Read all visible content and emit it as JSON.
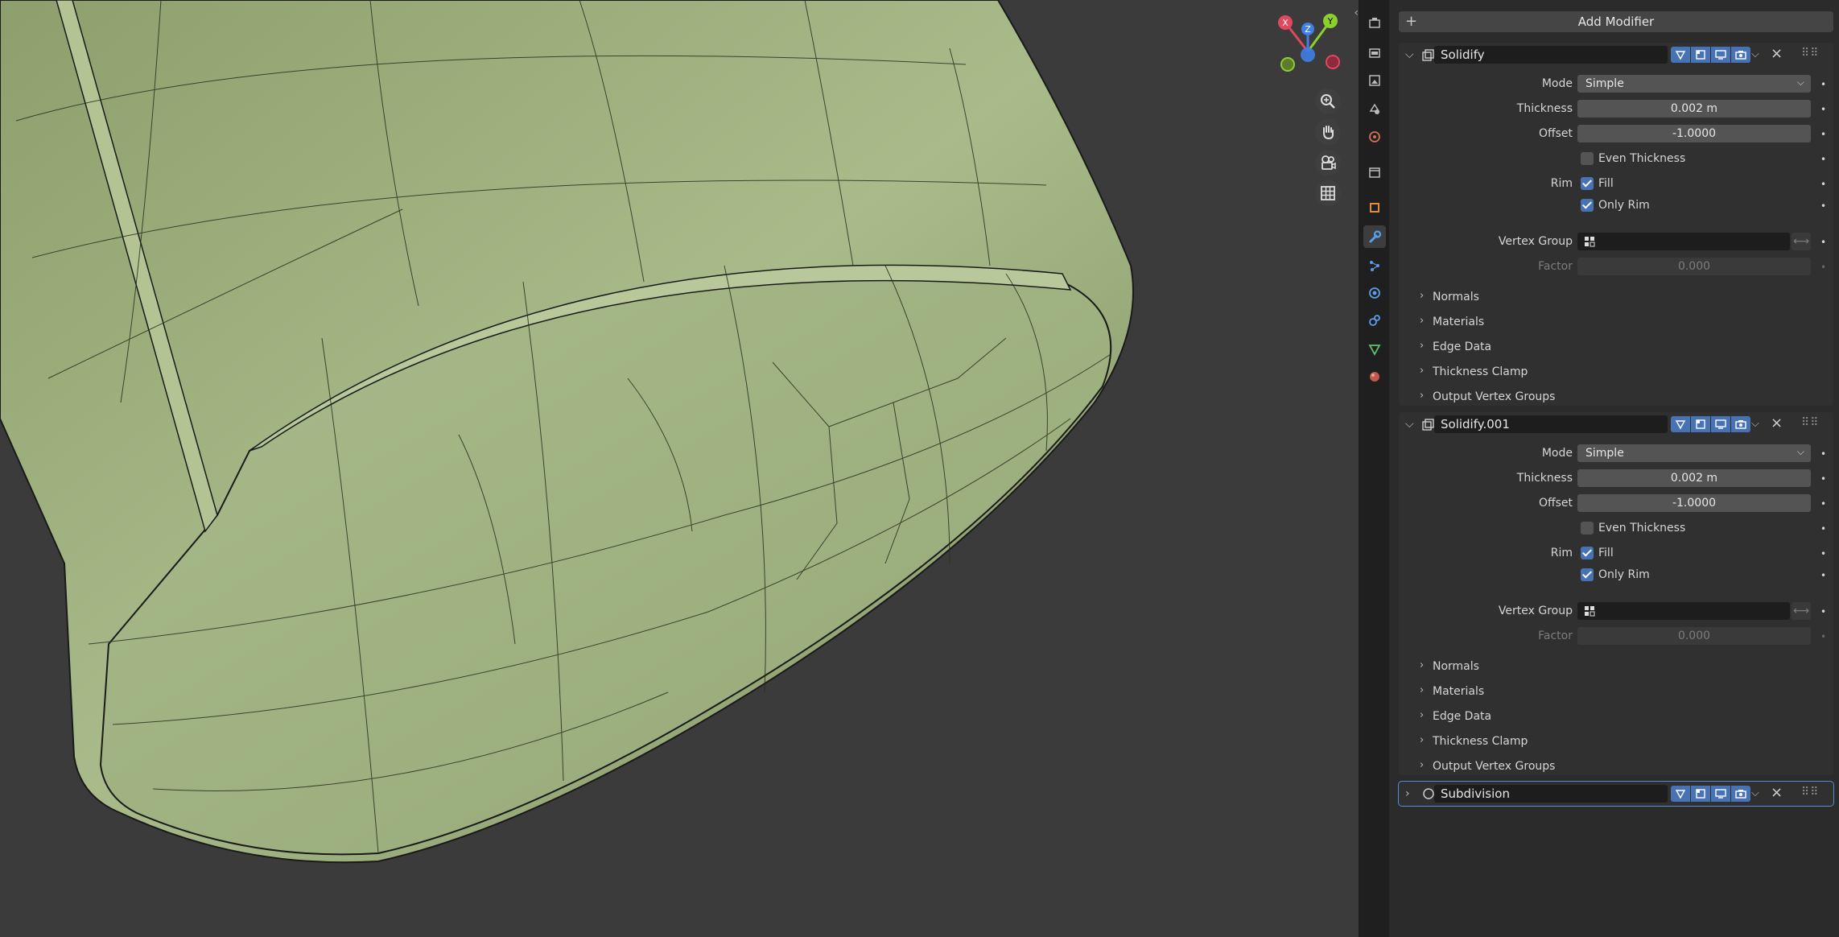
{
  "viewport": {
    "gizmo": {
      "x": "X",
      "y": "Y",
      "z": "Z"
    }
  },
  "panel": {
    "add_modifier": "Add Modifier",
    "modifiers": [
      {
        "name": "Solidify",
        "mode_label": "Mode",
        "mode": "Simple",
        "thickness_label": "Thickness",
        "thickness": "0.002 m",
        "offset_label": "Offset",
        "offset": "-1.0000",
        "even_thickness": "Even Thickness",
        "rim_label": "Rim",
        "fill": "Fill",
        "only_rim": "Only Rim",
        "vertex_group_label": "Vertex Group",
        "factor_label": "Factor",
        "factor": "0.000",
        "subpanels": [
          "Normals",
          "Materials",
          "Edge Data",
          "Thickness Clamp",
          "Output Vertex Groups"
        ]
      },
      {
        "name": "Solidify.001",
        "mode_label": "Mode",
        "mode": "Simple",
        "thickness_label": "Thickness",
        "thickness": "0.002 m",
        "offset_label": "Offset",
        "offset": "-1.0000",
        "even_thickness": "Even Thickness",
        "rim_label": "Rim",
        "fill": "Fill",
        "only_rim": "Only Rim",
        "vertex_group_label": "Vertex Group",
        "factor_label": "Factor",
        "factor": "0.000",
        "subpanels": [
          "Normals",
          "Materials",
          "Edge Data",
          "Thickness Clamp",
          "Output Vertex Groups"
        ]
      },
      {
        "name": "Subdivision"
      }
    ]
  },
  "colors": {
    "accent": "#4772b3",
    "mesh": "#a7b888",
    "viewport_bg": "#3b3b3b"
  }
}
